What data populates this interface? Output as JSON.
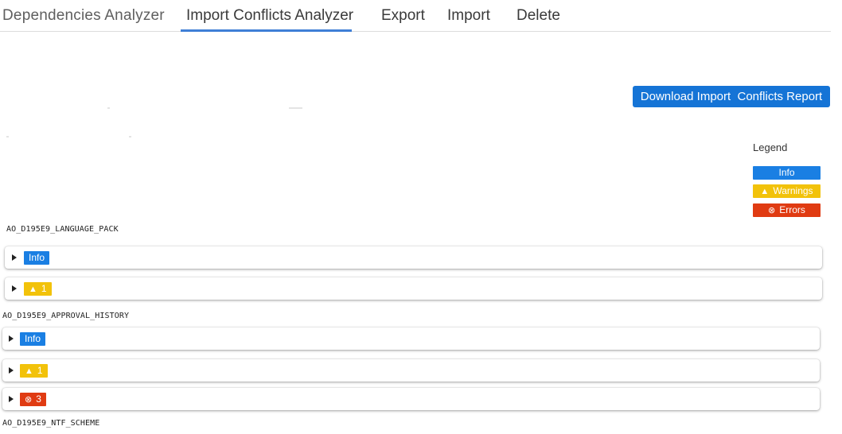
{
  "tabs": [
    {
      "label": "Dependencies Analyzer",
      "active": false
    },
    {
      "label": "Import Conflicts Analyzer",
      "active": true
    },
    {
      "label": "Export",
      "active": false
    },
    {
      "label": "Import",
      "active": false
    },
    {
      "label": "Delete",
      "active": false
    }
  ],
  "download_button": {
    "label": "Download Import  Conflicts Report"
  },
  "legend": {
    "title": "Legend",
    "items": [
      {
        "label": "Info",
        "icon": "none"
      },
      {
        "label": "Warnings",
        "icon": "warning-triangle-icon"
      },
      {
        "label": "Errors",
        "icon": "error-circle-x-icon"
      }
    ]
  },
  "sections": [
    {
      "name": "AO_D195E9_LANGUAGE_PACK",
      "rows": [
        {
          "type": "info",
          "label": "Info"
        },
        {
          "type": "warning",
          "count": "1"
        }
      ]
    },
    {
      "name": "AO_D195E9_APPROVAL_HISTORY",
      "rows": [
        {
          "type": "info",
          "label": "Info"
        },
        {
          "type": "warning",
          "count": "1"
        },
        {
          "type": "error",
          "count": "3"
        }
      ]
    },
    {
      "name": "AO_D195E9_NTF_SCHEME",
      "rows": []
    }
  ],
  "colors": {
    "info": "#1a7fe3",
    "warning": "#f2c20a",
    "error": "#e03b12",
    "button": "#1574d6",
    "tab_underline": "#3f7fd6"
  }
}
